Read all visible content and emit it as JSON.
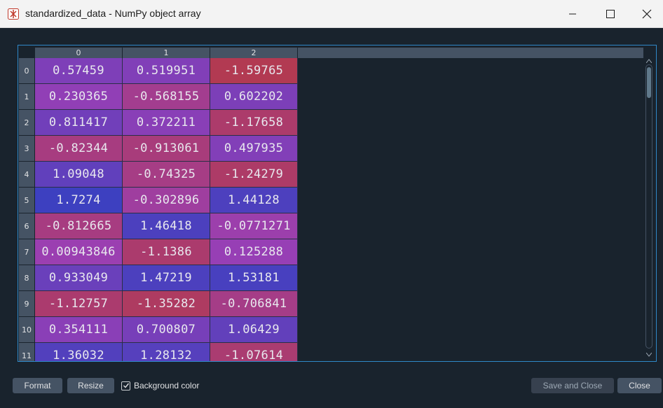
{
  "window": {
    "title": "standardized_data - NumPy object array",
    "app_icon": "spyder-app-icon",
    "controls": [
      "minimize-icon",
      "maximize-icon",
      "close-icon"
    ]
  },
  "table": {
    "column_headers": [
      "0",
      "1",
      "2"
    ],
    "row_headers": [
      "0",
      "1",
      "2",
      "3",
      "4",
      "5",
      "6",
      "7",
      "8",
      "9",
      "10",
      "11"
    ],
    "rows": [
      [
        "0.57459",
        "0.519951",
        "-1.59765"
      ],
      [
        "0.230365",
        "-0.568155",
        "0.602202"
      ],
      [
        "0.811417",
        "0.372211",
        "-1.17658"
      ],
      [
        "-0.82344",
        "-0.913061",
        "0.497935"
      ],
      [
        "1.09048",
        "-0.74325",
        "-1.24279"
      ],
      [
        "1.7274",
        "-0.302896",
        "1.44128"
      ],
      [
        "-0.812665",
        "1.46418",
        "-0.0771271"
      ],
      [
        "0.00943846",
        "-1.1386",
        "0.125288"
      ],
      [
        "0.933049",
        "1.47219",
        "1.53181"
      ],
      [
        "-1.12757",
        "-1.35282",
        "-0.706841"
      ],
      [
        "0.354111",
        "0.700807",
        "1.06429"
      ],
      [
        "1.36032",
        "1.28132",
        "-1.07614"
      ]
    ],
    "background_color_enabled": true,
    "value_range": [
      -1.6,
      1.75
    ],
    "color_high": "#3c40c0",
    "color_low": "#b23a52",
    "color_mid": "#9a3fb5"
  },
  "footer": {
    "format_label": "Format",
    "resize_label": "Resize",
    "background_color_label": "Background color",
    "save_close_label": "Save and Close",
    "close_label": "Close"
  }
}
